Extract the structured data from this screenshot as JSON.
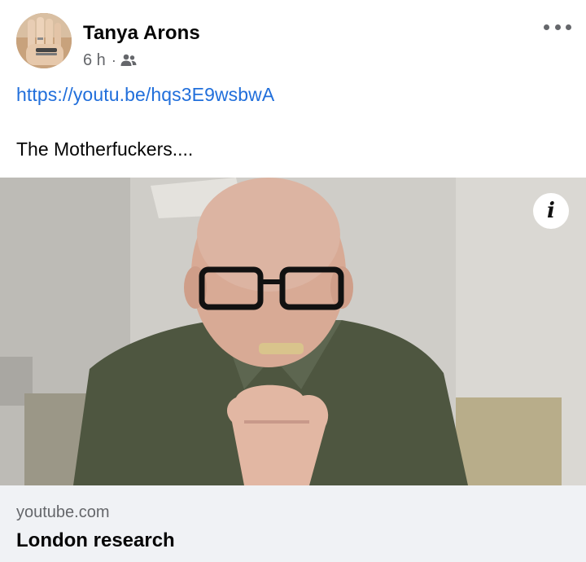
{
  "post": {
    "author": "Tanya Arons",
    "time": "6 h",
    "separator": "·",
    "audience_icon": "friends-icon",
    "more_icon": "more-options-icon",
    "link_url": "https://youtu.be/hqs3E9wsbwA",
    "text": "The Motherfuckers....",
    "info_icon_glyph": "i",
    "link_preview": {
      "domain": "youtube.com",
      "title": "London research"
    }
  },
  "colors": {
    "link": "#216fdb",
    "meta_text": "#65676b",
    "footer_bg": "#f0f2f5"
  }
}
